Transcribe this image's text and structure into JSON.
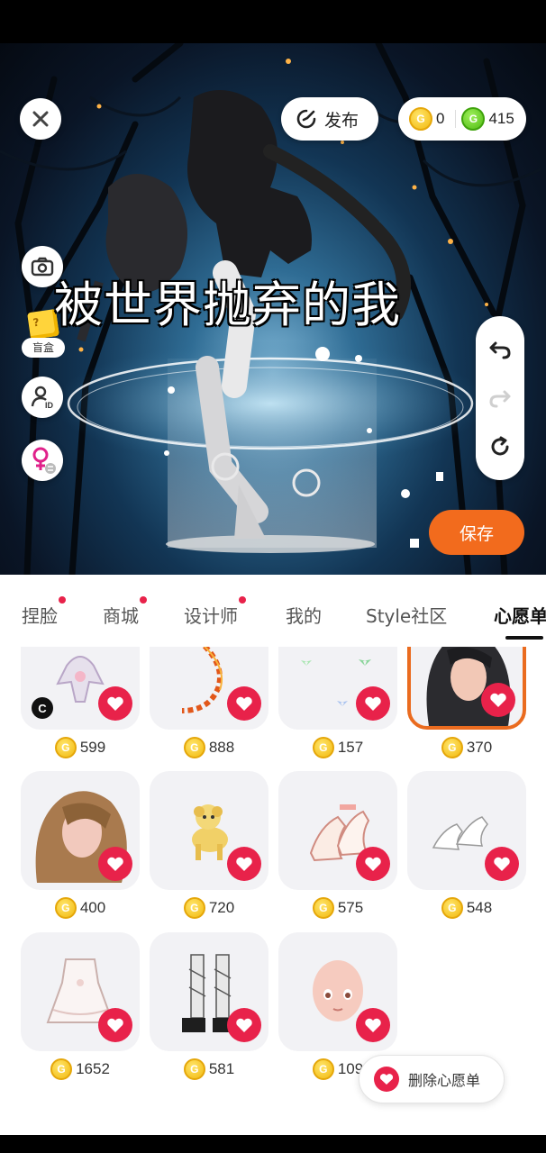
{
  "topbar": {
    "publish_label": "发布",
    "gold_coins": "0",
    "green_coins": "415"
  },
  "scene": {
    "title_text": "被世界抛弃的我",
    "blindbox_label": "盲盒",
    "save_label": "保存"
  },
  "tabs": [
    {
      "label": "捏脸",
      "dot": true
    },
    {
      "label": "商城",
      "dot": true
    },
    {
      "label": "设计师",
      "dot": true
    },
    {
      "label": "我的",
      "dot": false
    },
    {
      "label": "Style社区",
      "dot": false
    },
    {
      "label": "心愿单",
      "dot": false,
      "active": true
    }
  ],
  "items": [
    {
      "price": "599",
      "thumb": "doll-outfit-icon",
      "badge": "C"
    },
    {
      "price": "888",
      "thumb": "flame-chain-icon"
    },
    {
      "price": "157",
      "thumb": "butterflies-icon"
    },
    {
      "price": "370",
      "thumb": "black-hair-icon",
      "selected": true
    },
    {
      "price": "400",
      "thumb": "brown-hair-icon"
    },
    {
      "price": "720",
      "thumb": "yellow-puppy-icon"
    },
    {
      "price": "575",
      "thumb": "pink-heels-icon"
    },
    {
      "price": "548",
      "thumb": "white-heels-icon"
    },
    {
      "price": "1652",
      "thumb": "white-dress-icon"
    },
    {
      "price": "581",
      "thumb": "black-boots-icon"
    },
    {
      "price": "109",
      "thumb": "face-base-icon"
    }
  ],
  "wishlist": {
    "delete_label": "删除心愿单"
  },
  "colors": {
    "accent_orange": "#f26b1d",
    "heart_red": "#e8224a",
    "gold_coin": "#f2b90f",
    "green_coin": "#4fbb12"
  }
}
